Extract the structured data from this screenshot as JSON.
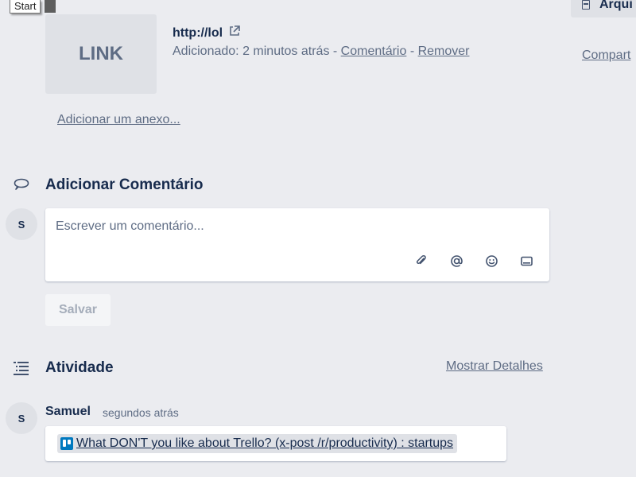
{
  "tooltip": {
    "text": "Start"
  },
  "sidebar": {
    "button_label": "Arqui",
    "share_link": "Compart"
  },
  "attachment": {
    "thumb_text": "LINK",
    "title": "http://lol",
    "meta_prefix": "Adicionado: 2 minutos atrás - ",
    "comment_link": "Comentário",
    "separator": " - ",
    "remove_link": "Remover",
    "add_link": "Adicionar um anexo..."
  },
  "comment": {
    "heading": "Adicionar Comentário",
    "avatar_initial": "S",
    "placeholder": "Escrever um comentário...",
    "tools": [
      "paperclip-icon",
      "at-mention-icon",
      "emoji-icon",
      "card-icon"
    ],
    "save_label": "Salvar"
  },
  "activity": {
    "heading": "Atividade",
    "details_link": "Mostrar Detalhes",
    "items": [
      {
        "avatar_initial": "S",
        "user": "Samuel",
        "time": "segundos atrás",
        "link_text": "What DON'T you like about Trello? (x-post /r/productivity) : startups"
      }
    ]
  },
  "colors": {
    "background": "#ebecf0",
    "text_primary": "#172b4d",
    "text_secondary": "#5e6c84",
    "trello_blue": "#0079bf"
  }
}
